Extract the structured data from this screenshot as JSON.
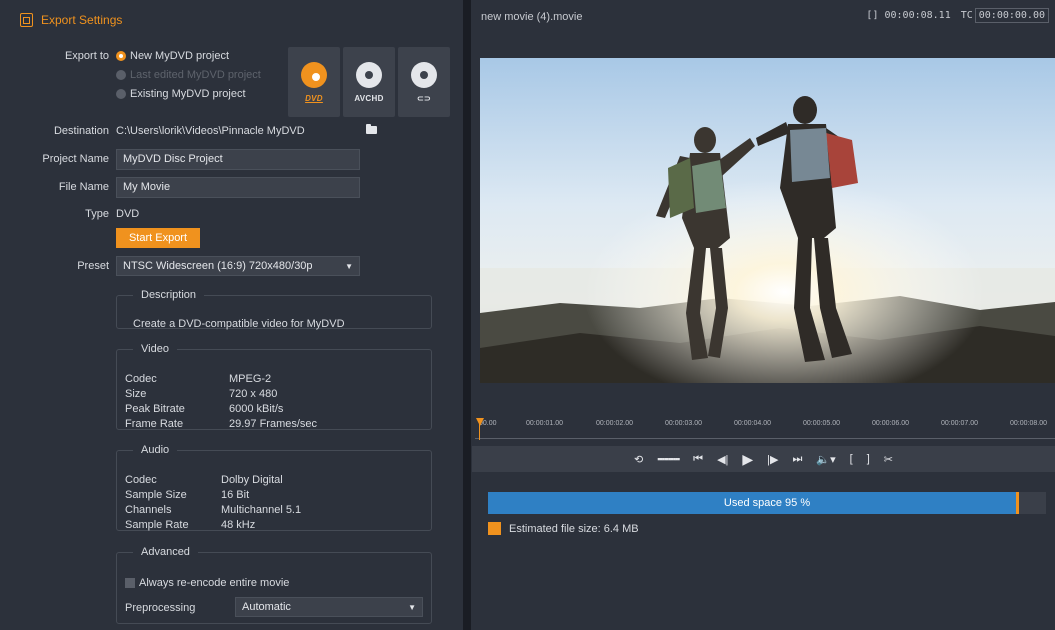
{
  "panel": {
    "title": "Export Settings"
  },
  "export_to": {
    "label": "Export to",
    "options": [
      "New MyDVD project",
      "Last edited MyDVD project",
      "Existing MyDVD project"
    ],
    "selected": "New MyDVD project",
    "disabled": "Last edited MyDVD project"
  },
  "formats": [
    {
      "label": "DVD",
      "selected": true
    },
    {
      "label": "AVCHD",
      "selected": false
    },
    {
      "label": "Blu-ray",
      "selected": false
    }
  ],
  "destination": {
    "label": "Destination",
    "value": "C:\\Users\\lorik\\Videos\\Pinnacle MyDVD"
  },
  "project_name": {
    "label": "Project Name",
    "value": "MyDVD Disc Project"
  },
  "file_name": {
    "label": "File Name",
    "value": "My Movie"
  },
  "type": {
    "label": "Type",
    "value": "DVD"
  },
  "start_export": "Start Export",
  "preset": {
    "label": "Preset",
    "value": "NTSC Widescreen (16:9) 720x480/30p"
  },
  "description": {
    "legend": "Description",
    "text": "Create a DVD-compatible video for MyDVD"
  },
  "video": {
    "legend": "Video",
    "rows": [
      {
        "k": "Codec",
        "v": "MPEG-2"
      },
      {
        "k": "Size",
        "v": "720 x 480"
      },
      {
        "k": "Peak Bitrate",
        "v": "6000 kBit/s"
      },
      {
        "k": "Frame Rate",
        "v": "29.97 Frames/sec"
      }
    ]
  },
  "audio": {
    "legend": "Audio",
    "rows": [
      {
        "k": "Codec",
        "v": "Dolby Digital"
      },
      {
        "k": "Sample Size",
        "v": "16 Bit"
      },
      {
        "k": "Channels",
        "v": "Multichannel 5.1"
      },
      {
        "k": "Sample Rate",
        "v": "48 kHz"
      }
    ]
  },
  "advanced": {
    "legend": "Advanced",
    "reencode_label": "Always re-encode entire movie",
    "reencode_checked": false,
    "preprocessing_label": "Preprocessing",
    "preprocessing_value": "Automatic"
  },
  "preview": {
    "file_title": "new movie (4).movie",
    "duration": "[] 00:00:08.11",
    "tc_label": "TC",
    "tc_value": "00:00:00.00"
  },
  "timeline": {
    "labels": [
      "00.00",
      "00:00:01.00",
      "00:00:02.00",
      "00:00:03.00",
      "00:00:04.00",
      "00:00:05.00",
      "00:00:06.00",
      "00:00:07.00",
      "00:00:08.00"
    ]
  },
  "usage": {
    "text": "Used space 95 %",
    "percent": 95
  },
  "estimate": {
    "text": "Estimated file size: 6.4 MB"
  },
  "colors": {
    "accent": "#f0921e",
    "usage_bar": "#2f80c4"
  }
}
